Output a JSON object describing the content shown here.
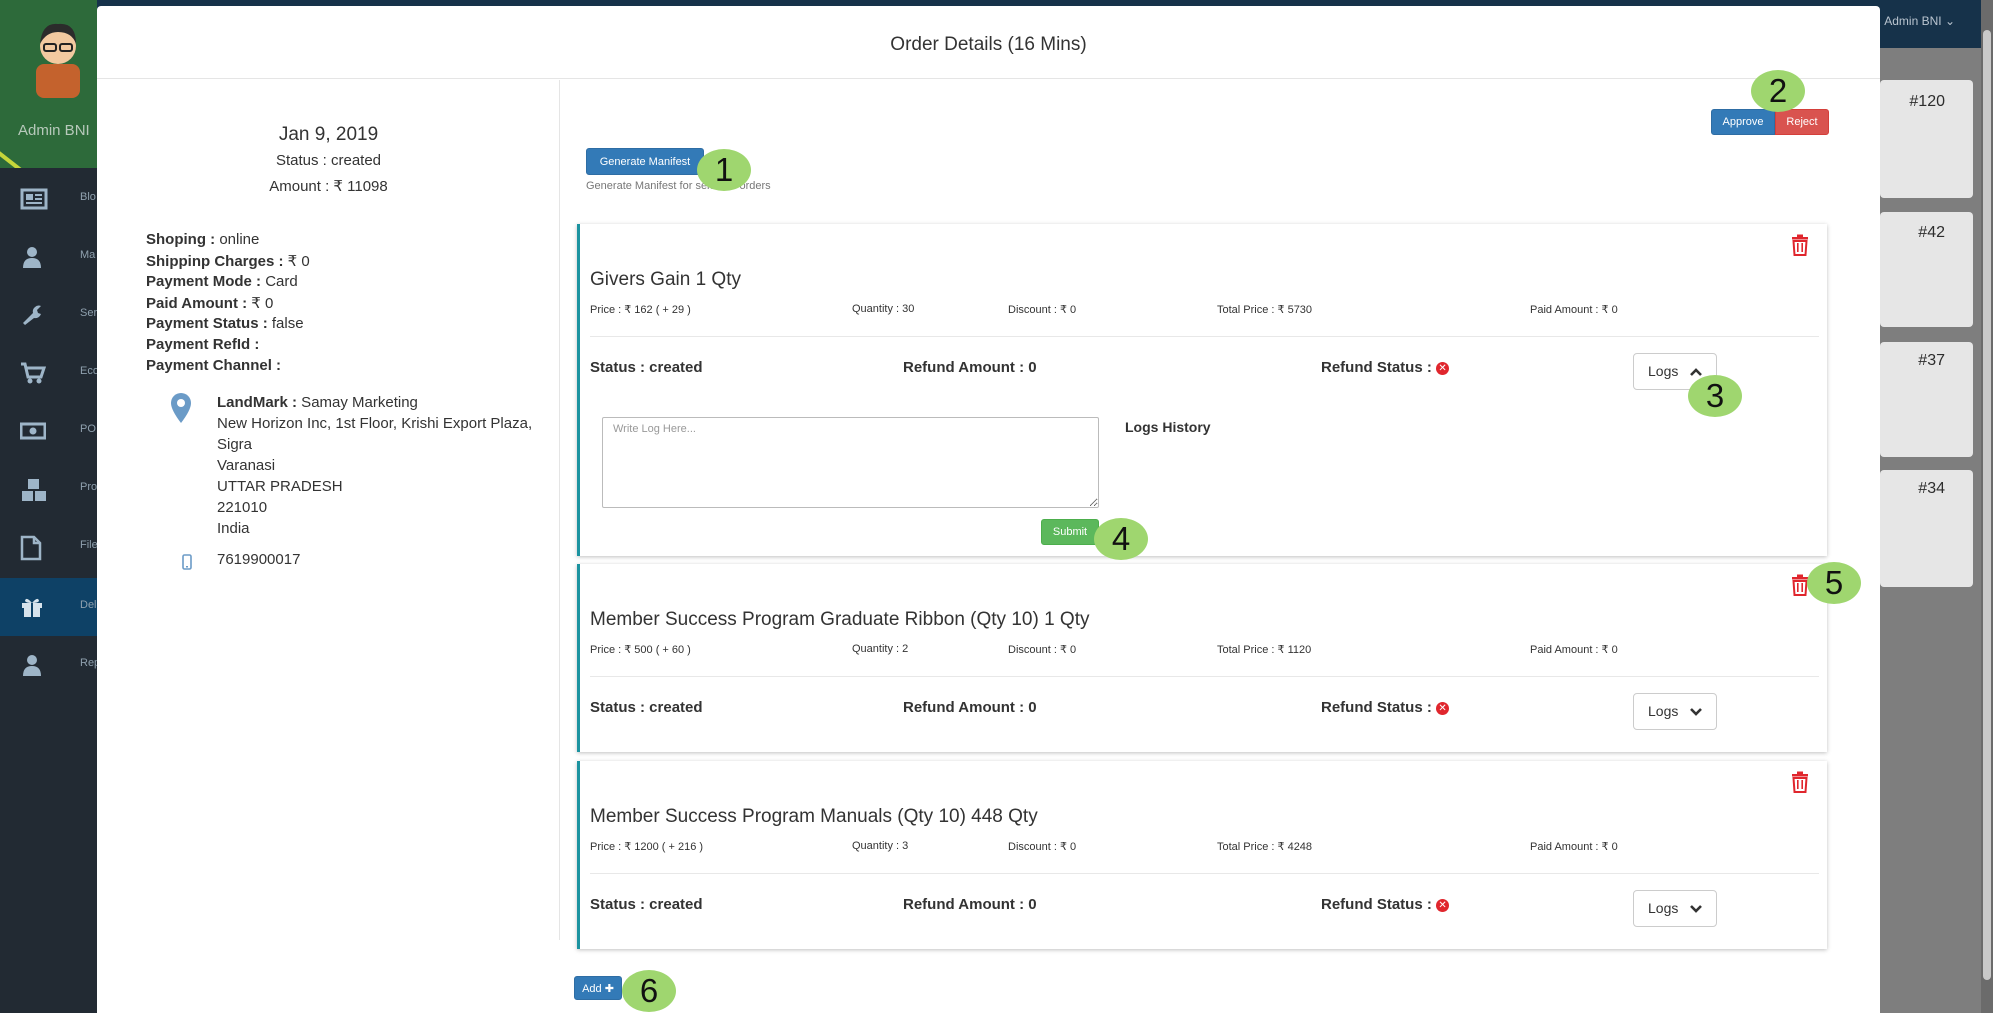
{
  "background": {
    "admin_top": "Admin BNI",
    "admin_name": "Admin BNI",
    "sidebar_items": [
      {
        "label": "Blo",
        "icon": "newspaper-icon"
      },
      {
        "label": "Ma",
        "icon": "user-icon"
      },
      {
        "label": "Ser",
        "icon": "wrench-icon"
      },
      {
        "label": "Eco",
        "icon": "cart-icon"
      },
      {
        "label": "PO",
        "icon": "money-icon"
      },
      {
        "label": "Pro",
        "icon": "cubes-icon"
      },
      {
        "label": "File",
        "icon": "file-icon"
      },
      {
        "label": "Del",
        "icon": "gift-icon"
      },
      {
        "label": "Rep",
        "icon": "user-icon"
      }
    ],
    "card_numbers": [
      "#120",
      "#42",
      "#37",
      "#34"
    ]
  },
  "modal": {
    "title": "Order Details (16 Mins)"
  },
  "order": {
    "date": "Jan 9, 2019",
    "status": "Status : created",
    "amount": "Amount : ₹ 11098",
    "fields": [
      {
        "label": "Shoping :",
        "value": " online"
      },
      {
        "label": "Shippinp Charges :",
        "value": " ₹ 0"
      },
      {
        "label": "Payment Mode :",
        "value": " Card"
      },
      {
        "label": "Paid Amount :",
        "value": " ₹ 0"
      },
      {
        "label": "Payment Status :",
        "value": " false"
      },
      {
        "label": "Payment RefId :",
        "value": ""
      },
      {
        "label": "Payment Channel :",
        "value": ""
      }
    ],
    "address": {
      "landmark_label": "LandMark :",
      "landmark_value": " Samay Marketing",
      "lines": [
        "New Horizon Inc, 1st Floor, Krishi Export Plaza,",
        "Sigra",
        "Varanasi",
        "UTTAR PRADESH",
        "221010",
        "India"
      ],
      "phone": "7619900017"
    }
  },
  "actions": {
    "generate_manifest": "Generate Manifest",
    "manifest_hint": "Generate Manifest for selected orders",
    "approve": "Approve",
    "reject": "Reject",
    "add": "Add"
  },
  "items": [
    {
      "name": "Givers Gain 1 Qty",
      "price": "Price : ₹ 162 ( + 29 )",
      "quantity": "Quantity : 30",
      "discount": "Discount : ₹ 0",
      "total": "Total Price : ₹ 5730",
      "paid": "Paid Amount : ₹ 0",
      "status": "Status : created",
      "refund_amount": "Refund Amount : 0",
      "refund_status": "Refund Status :",
      "logs": "Logs",
      "expanded": true
    },
    {
      "name": "Member Success Program Graduate Ribbon (Qty 10) 1 Qty",
      "price": "Price : ₹ 500 ( + 60 )",
      "quantity": "Quantity : 2",
      "discount": "Discount : ₹ 0",
      "total": "Total Price : ₹ 1120",
      "paid": "Paid Amount : ₹ 0",
      "status": "Status : created",
      "refund_amount": "Refund Amount : 0",
      "refund_status": "Refund Status :",
      "logs": "Logs",
      "expanded": false
    },
    {
      "name": "Member Success Program Manuals (Qty 10) 448 Qty",
      "price": "Price : ₹ 1200 ( + 216 )",
      "quantity": "Quantity : 3",
      "discount": "Discount : ₹ 0",
      "total": "Total Price : ₹ 4248",
      "paid": "Paid Amount : ₹ 0",
      "status": "Status : created",
      "refund_amount": "Refund Amount : 0",
      "refund_status": "Refund Status :",
      "logs": "Logs",
      "expanded": false
    }
  ],
  "log_panel": {
    "placeholder": "Write Log Here...",
    "history_label": "Logs History",
    "submit": "Submit"
  },
  "markers": [
    "1",
    "2",
    "3",
    "4",
    "5",
    "6"
  ],
  "colors": {
    "accent_blue": "#337ab7",
    "danger_red": "#d9534f",
    "success_green": "#5cb85c",
    "item_border": "#1c93a0",
    "marker_green": "#9fd66f",
    "trash_red": "#e0262d"
  }
}
